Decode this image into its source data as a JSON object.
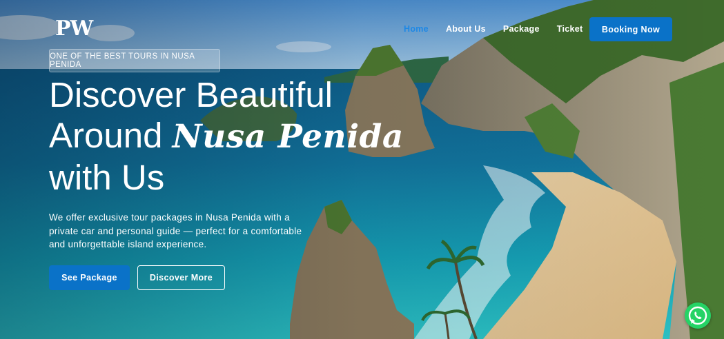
{
  "brand": {
    "logo_text": "PW"
  },
  "nav": {
    "items": [
      {
        "label": "Home",
        "active": true
      },
      {
        "label": "About Us",
        "active": false
      },
      {
        "label": "Package",
        "active": false
      },
      {
        "label": "Ticket",
        "active": false
      }
    ],
    "booking_label": "Booking Now"
  },
  "hero": {
    "tagline": "ONE OF THE BEST TOURS IN NUSA PENIDA",
    "headline_line1": "Discover Beautiful",
    "headline_line2_prefix": "Around",
    "headline_accent": "Nusa Penida",
    "headline_line3": "with Us",
    "description": "We offer exclusive tour packages in Nusa Penida with a private car and personal guide — perfect for a comfortable and unforgettable island experience.",
    "primary_button": "See Package",
    "secondary_button": "Discover More"
  },
  "floating": {
    "icon": "whatsapp-icon"
  },
  "colors": {
    "accent": "#0a72c8",
    "active_nav": "#1e88e5",
    "whatsapp": "#25d366"
  }
}
